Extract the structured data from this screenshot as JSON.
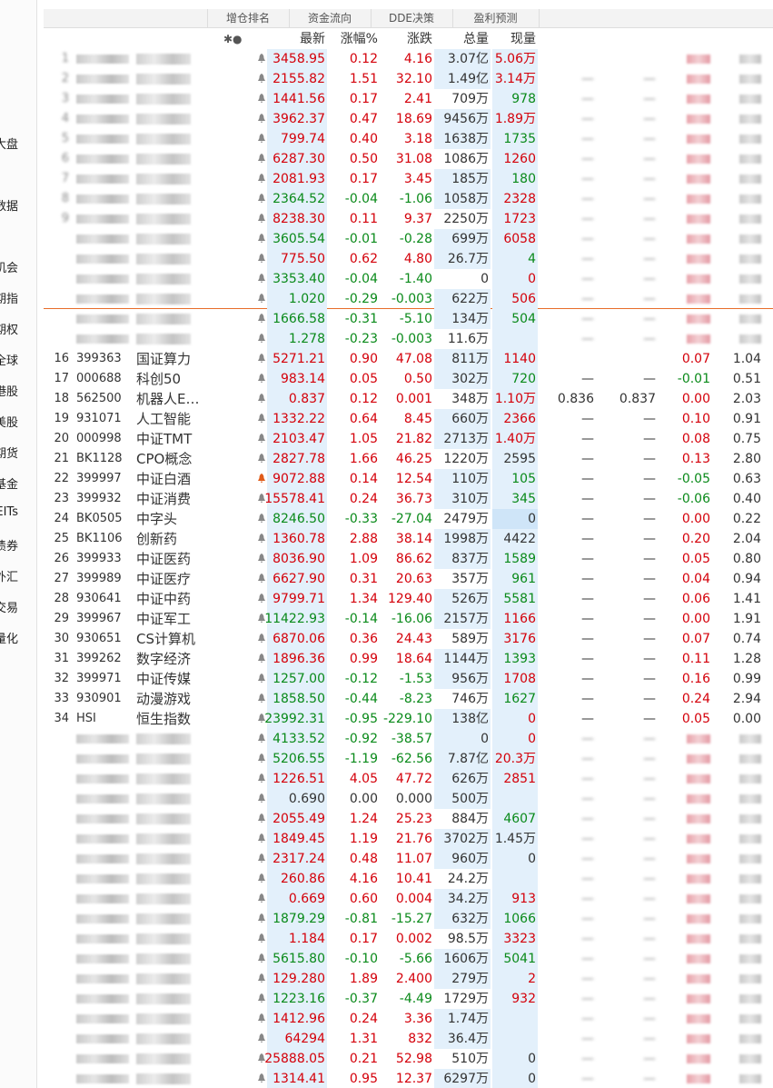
{
  "sidebar": {
    "items": [
      "大盘",
      "数据",
      "机会",
      "期指",
      "期权",
      "全球",
      "港股",
      "美股",
      "期货",
      "基金",
      "REITs",
      "债券",
      "外汇",
      "交易",
      "量化"
    ]
  },
  "top_tabs": [
    "增仓排名",
    "资金流向",
    "DDE决策",
    "盈利预测"
  ],
  "header": {
    "icons_label": "✱●",
    "latest": "最新",
    "pct": "涨幅%",
    "change": "涨跌",
    "volume": "总量",
    "now_vol": "现量"
  },
  "colors": {
    "up": "#d4000a",
    "down": "#0a8a1a",
    "highlight": "#e3f0fb",
    "bell": "#888888",
    "bell_active": "#e05c1a",
    "separator": "#e76d2a"
  },
  "rows": [
    {
      "idx": "1",
      "code": "",
      "name": "",
      "latest": "3458.95",
      "pct": "0.12",
      "chg": "4.16",
      "vol": "3.07亿",
      "now": "5.06万",
      "dir": "up",
      "c1": "",
      "c2": "",
      "c3": "",
      "c4": "",
      "blurred": true,
      "now_dir": "up"
    },
    {
      "idx": "2",
      "code": "",
      "name": "",
      "latest": "2155.82",
      "pct": "1.51",
      "chg": "32.10",
      "vol": "1.49亿",
      "now": "3.14万",
      "dir": "up",
      "c1": "—",
      "c2": "—",
      "c3": "",
      "c4": "",
      "blurred": true,
      "now_dir": "up"
    },
    {
      "idx": "3",
      "code": "",
      "name": "",
      "latest": "1441.56",
      "pct": "0.17",
      "chg": "2.41",
      "vol": "709万",
      "now": "978",
      "dir": "up",
      "c1": "—",
      "c2": "—",
      "c3": "",
      "c4": "",
      "blurred": true,
      "now_dir": "down"
    },
    {
      "idx": "4",
      "code": "",
      "name": "",
      "latest": "3962.37",
      "pct": "0.47",
      "chg": "18.69",
      "vol": "9456万",
      "now": "1.89万",
      "dir": "up",
      "c1": "—",
      "c2": "—",
      "c3": "",
      "c4": "",
      "blurred": true,
      "now_dir": "up"
    },
    {
      "idx": "5",
      "code": "",
      "name": "",
      "latest": "799.74",
      "pct": "0.40",
      "chg": "3.18",
      "vol": "1638万",
      "now": "1735",
      "dir": "up",
      "c1": "—",
      "c2": "—",
      "c3": "",
      "c4": "",
      "blurred": true,
      "now_dir": "down"
    },
    {
      "idx": "6",
      "code": "",
      "name": "",
      "latest": "6287.30",
      "pct": "0.50",
      "chg": "31.08",
      "vol": "1086万",
      "now": "1260",
      "dir": "up",
      "c1": "—",
      "c2": "—",
      "c3": "",
      "c4": "",
      "blurred": true,
      "now_dir": "up"
    },
    {
      "idx": "7",
      "code": "",
      "name": "",
      "latest": "2081.93",
      "pct": "0.17",
      "chg": "3.45",
      "vol": "185万",
      "now": "180",
      "dir": "up",
      "c1": "—",
      "c2": "—",
      "c3": "",
      "c4": "",
      "blurred": true,
      "now_dir": "down"
    },
    {
      "idx": "8",
      "code": "",
      "name": "",
      "latest": "2364.52",
      "pct": "-0.04",
      "chg": "-1.06",
      "vol": "1058万",
      "now": "2328",
      "dir": "down",
      "c1": "—",
      "c2": "—",
      "c3": "",
      "c4": "",
      "blurred": true,
      "now_dir": "up"
    },
    {
      "idx": "9",
      "code": "",
      "name": "",
      "latest": "8238.30",
      "pct": "0.11",
      "chg": "9.37",
      "vol": "2250万",
      "now": "1723",
      "dir": "up",
      "c1": "—",
      "c2": "—",
      "c3": "",
      "c4": "",
      "blurred": true,
      "now_dir": "up"
    },
    {
      "idx": "",
      "code": "",
      "name": "",
      "latest": "3605.54",
      "pct": "-0.01",
      "chg": "-0.28",
      "vol": "699万",
      "now": "6058",
      "dir": "down",
      "c1": "—",
      "c2": "—",
      "c3": "",
      "c4": "",
      "blurred": true,
      "now_dir": "up"
    },
    {
      "idx": "",
      "code": "",
      "name": "",
      "latest": "775.50",
      "pct": "0.62",
      "chg": "4.80",
      "vol": "26.7万",
      "now": "4",
      "dir": "up",
      "c1": "—",
      "c2": "—",
      "c3": "",
      "c4": "",
      "blurred": true,
      "now_dir": "down"
    },
    {
      "idx": "",
      "code": "",
      "name": "",
      "latest": "3353.40",
      "pct": "-0.04",
      "chg": "-1.40",
      "vol": "0",
      "now": "0",
      "dir": "down",
      "c1": "—",
      "c2": "—",
      "c3": "",
      "c4": "",
      "blurred": true,
      "now_dir": "up"
    },
    {
      "idx": "",
      "code": "",
      "name": "",
      "latest": "1.020",
      "pct": "-0.29",
      "chg": "-0.003",
      "vol": "622万",
      "now": "506",
      "dir": "down",
      "c1": "—",
      "c2": "—",
      "c3": "",
      "c4": "",
      "blurred": true,
      "now_dir": "up"
    },
    {
      "idx": "",
      "code": "",
      "name": "",
      "latest": "1666.58",
      "pct": "-0.31",
      "chg": "-5.10",
      "vol": "134万",
      "now": "504",
      "dir": "down",
      "c1": "—",
      "c2": "—",
      "c3": "",
      "c4": "",
      "blurred": true,
      "now_dir": "down"
    },
    {
      "idx": "",
      "code": "",
      "name": "",
      "latest": "1.278",
      "pct": "-0.23",
      "chg": "-0.003",
      "vol": "11.6万",
      "now": "",
      "dir": "down",
      "c1": "—",
      "c2": "—",
      "c3": "",
      "c4": "",
      "blurred": true,
      "now_dir": "down"
    },
    {
      "idx": "16",
      "code": "399363",
      "name": "国证算力",
      "latest": "5271.21",
      "pct": "0.90",
      "chg": "47.08",
      "vol": "811万",
      "now": "1140",
      "dir": "up",
      "c1": "",
      "c2": "",
      "c3": "0.07",
      "c4": "1.04",
      "blurred": false,
      "now_dir": "up"
    },
    {
      "idx": "17",
      "code": "000688",
      "name": "科创50",
      "latest": "983.14",
      "pct": "0.05",
      "chg": "0.50",
      "vol": "302万",
      "now": "720",
      "dir": "up",
      "c1": "—",
      "c2": "—",
      "c3": "-0.01",
      "c4": "0.51",
      "blurred": false,
      "now_dir": "down"
    },
    {
      "idx": "18",
      "code": "562500",
      "name": "机器人E…",
      "latest": "0.837",
      "pct": "0.12",
      "chg": "0.001",
      "vol": "348万",
      "now": "1.10万",
      "dir": "up",
      "c1": "0.836",
      "c2": "0.837",
      "c3": "0.00",
      "c4": "2.03",
      "blurred": false,
      "now_dir": "up"
    },
    {
      "idx": "19",
      "code": "931071",
      "name": "人工智能",
      "latest": "1332.22",
      "pct": "0.64",
      "chg": "8.45",
      "vol": "660万",
      "now": "2366",
      "dir": "up",
      "c1": "—",
      "c2": "—",
      "c3": "0.10",
      "c4": "0.91",
      "blurred": false,
      "now_dir": "up"
    },
    {
      "idx": "20",
      "code": "000998",
      "name": "中证TMT",
      "latest": "2103.47",
      "pct": "1.05",
      "chg": "21.82",
      "vol": "2713万",
      "now": "1.40万",
      "dir": "up",
      "c1": "—",
      "c2": "—",
      "c3": "0.08",
      "c4": "0.75",
      "blurred": false,
      "now_dir": "up"
    },
    {
      "idx": "21",
      "code": "BK1128",
      "name": "CPO概念",
      "latest": "2827.78",
      "pct": "1.66",
      "chg": "46.25",
      "vol": "1220万",
      "now": "2595",
      "dir": "up",
      "c1": "—",
      "c2": "—",
      "c3": "0.13",
      "c4": "2.80",
      "blurred": false,
      "now_dir": "blk"
    },
    {
      "idx": "22",
      "code": "399997",
      "name": "中证白酒",
      "latest": "9072.88",
      "pct": "0.14",
      "chg": "12.54",
      "vol": "110万",
      "now": "105",
      "dir": "up",
      "c1": "—",
      "c2": "—",
      "c3": "-0.05",
      "c4": "0.63",
      "blurred": false,
      "now_dir": "down"
    },
    {
      "idx": "23",
      "code": "399932",
      "name": "中证消费",
      "latest": "15578.41",
      "pct": "0.24",
      "chg": "36.73",
      "vol": "310万",
      "now": "345",
      "dir": "up",
      "c1": "—",
      "c2": "—",
      "c3": "-0.06",
      "c4": "0.40",
      "blurred": false,
      "now_dir": "down"
    },
    {
      "idx": "24",
      "code": "BK0505",
      "name": "中字头",
      "latest": "8246.50",
      "pct": "-0.33",
      "chg": "-27.04",
      "vol": "2479万",
      "now": "0",
      "dir": "down",
      "c1": "—",
      "c2": "—",
      "c3": "0.00",
      "c4": "0.22",
      "blurred": false,
      "now_dir": "blk"
    },
    {
      "idx": "25",
      "code": "BK1106",
      "name": "创新药",
      "latest": "1360.78",
      "pct": "2.88",
      "chg": "38.14",
      "vol": "1998万",
      "now": "4422",
      "dir": "up",
      "c1": "—",
      "c2": "—",
      "c3": "0.20",
      "c4": "2.04",
      "blurred": false,
      "now_dir": "blk"
    },
    {
      "idx": "26",
      "code": "399933",
      "name": "中证医药",
      "latest": "8036.90",
      "pct": "1.09",
      "chg": "86.62",
      "vol": "837万",
      "now": "1589",
      "dir": "up",
      "c1": "—",
      "c2": "—",
      "c3": "0.05",
      "c4": "0.80",
      "blurred": false,
      "now_dir": "down"
    },
    {
      "idx": "27",
      "code": "399989",
      "name": "中证医疗",
      "latest": "6627.90",
      "pct": "0.31",
      "chg": "20.63",
      "vol": "357万",
      "now": "961",
      "dir": "up",
      "c1": "—",
      "c2": "—",
      "c3": "0.04",
      "c4": "0.94",
      "blurred": false,
      "now_dir": "down"
    },
    {
      "idx": "28",
      "code": "930641",
      "name": "中证中药",
      "latest": "9799.71",
      "pct": "1.34",
      "chg": "129.40",
      "vol": "526万",
      "now": "5581",
      "dir": "up",
      "c1": "—",
      "c2": "—",
      "c3": "0.06",
      "c4": "1.41",
      "blurred": false,
      "now_dir": "down"
    },
    {
      "idx": "29",
      "code": "399967",
      "name": "中证军工",
      "latest": "11422.93",
      "pct": "-0.14",
      "chg": "-16.06",
      "vol": "2157万",
      "now": "1166",
      "dir": "down",
      "c1": "—",
      "c2": "—",
      "c3": "0.00",
      "c4": "1.91",
      "blurred": false,
      "now_dir": "up"
    },
    {
      "idx": "30",
      "code": "930651",
      "name": "CS计算机",
      "latest": "6870.06",
      "pct": "0.36",
      "chg": "24.43",
      "vol": "589万",
      "now": "3176",
      "dir": "up",
      "c1": "—",
      "c2": "—",
      "c3": "0.07",
      "c4": "0.74",
      "blurred": false,
      "now_dir": "up"
    },
    {
      "idx": "31",
      "code": "399262",
      "name": "数字经济",
      "latest": "1896.36",
      "pct": "0.99",
      "chg": "18.64",
      "vol": "1144万",
      "now": "1393",
      "dir": "up",
      "c1": "—",
      "c2": "—",
      "c3": "0.11",
      "c4": "1.28",
      "blurred": false,
      "now_dir": "down"
    },
    {
      "idx": "32",
      "code": "399971",
      "name": "中证传媒",
      "latest": "1257.00",
      "pct": "-0.12",
      "chg": "-1.53",
      "vol": "956万",
      "now": "1708",
      "dir": "down",
      "c1": "—",
      "c2": "—",
      "c3": "0.16",
      "c4": "0.99",
      "blurred": false,
      "now_dir": "up"
    },
    {
      "idx": "33",
      "code": "930901",
      "name": "动漫游戏",
      "latest": "1858.50",
      "pct": "-0.44",
      "chg": "-8.23",
      "vol": "746万",
      "now": "1627",
      "dir": "down",
      "c1": "—",
      "c2": "—",
      "c3": "0.24",
      "c4": "2.94",
      "blurred": false,
      "now_dir": "down"
    },
    {
      "idx": "34",
      "code": "HSI",
      "name": "恒生指数",
      "latest": "23992.31",
      "pct": "-0.95",
      "chg": "-229.10",
      "vol": "138亿",
      "now": "0",
      "dir": "down",
      "c1": "—",
      "c2": "—",
      "c3": "0.05",
      "c4": "0.00",
      "blurred": false,
      "now_dir": "up"
    },
    {
      "idx": "",
      "code": "",
      "name": "",
      "latest": "4133.52",
      "pct": "-0.92",
      "chg": "-38.57",
      "vol": "0",
      "now": "0",
      "dir": "down",
      "c1": "—",
      "c2": "—",
      "c3": "",
      "c4": "",
      "blurred": true,
      "now_dir": "up"
    },
    {
      "idx": "",
      "code": "",
      "name": "",
      "latest": "5206.55",
      "pct": "-1.19",
      "chg": "-62.56",
      "vol": "7.87亿",
      "now": "20.3万",
      "dir": "down",
      "c1": "—",
      "c2": "—",
      "c3": "",
      "c4": "",
      "blurred": true,
      "now_dir": "up"
    },
    {
      "idx": "",
      "code": "",
      "name": "",
      "latest": "1226.51",
      "pct": "4.05",
      "chg": "47.72",
      "vol": "626万",
      "now": "2851",
      "dir": "up",
      "c1": "—",
      "c2": "—",
      "c3": "",
      "c4": "",
      "blurred": true,
      "now_dir": "up"
    },
    {
      "idx": "",
      "code": "",
      "name": "",
      "latest": "0.690",
      "pct": "0.00",
      "chg": "0.000",
      "vol": "500万",
      "now": "",
      "dir": "blk",
      "c1": "—",
      "c2": "—",
      "c3": "",
      "c4": "",
      "blurred": true,
      "now_dir": "up"
    },
    {
      "idx": "",
      "code": "",
      "name": "",
      "latest": "2055.49",
      "pct": "1.24",
      "chg": "25.23",
      "vol": "884万",
      "now": "4607",
      "dir": "up",
      "c1": "—",
      "c2": "—",
      "c3": "",
      "c4": "",
      "blurred": true,
      "now_dir": "down"
    },
    {
      "idx": "",
      "code": "",
      "name": "",
      "latest": "1849.45",
      "pct": "1.19",
      "chg": "21.76",
      "vol": "3702万",
      "now": "1.45万",
      "dir": "up",
      "c1": "—",
      "c2": "—",
      "c3": "",
      "c4": "",
      "blurred": true,
      "now_dir": "blk"
    },
    {
      "idx": "",
      "code": "",
      "name": "",
      "latest": "2317.24",
      "pct": "0.48",
      "chg": "11.07",
      "vol": "960万",
      "now": "0",
      "dir": "up",
      "c1": "—",
      "c2": "—",
      "c3": "",
      "c4": "",
      "blurred": true,
      "now_dir": "blk"
    },
    {
      "idx": "",
      "code": "",
      "name": "",
      "latest": "260.86",
      "pct": "4.16",
      "chg": "10.41",
      "vol": "24.2万",
      "now": "",
      "dir": "up",
      "c1": "—",
      "c2": "—",
      "c3": "",
      "c4": "",
      "blurred": true,
      "now_dir": "down"
    },
    {
      "idx": "",
      "code": "",
      "name": "",
      "latest": "0.669",
      "pct": "0.60",
      "chg": "0.004",
      "vol": "34.2万",
      "now": "913",
      "dir": "up",
      "c1": "—",
      "c2": "—",
      "c3": "",
      "c4": "",
      "blurred": true,
      "now_dir": "up"
    },
    {
      "idx": "",
      "code": "",
      "name": "",
      "latest": "1879.29",
      "pct": "-0.81",
      "chg": "-15.27",
      "vol": "632万",
      "now": "1066",
      "dir": "down",
      "c1": "—",
      "c2": "—",
      "c3": "",
      "c4": "",
      "blurred": true,
      "now_dir": "down"
    },
    {
      "idx": "",
      "code": "",
      "name": "",
      "latest": "1.184",
      "pct": "0.17",
      "chg": "0.002",
      "vol": "98.5万",
      "now": "3323",
      "dir": "up",
      "c1": "—",
      "c2": "—",
      "c3": "",
      "c4": "",
      "blurred": true,
      "now_dir": "up"
    },
    {
      "idx": "",
      "code": "",
      "name": "",
      "latest": "5615.80",
      "pct": "-0.10",
      "chg": "-5.66",
      "vol": "1606万",
      "now": "5041",
      "dir": "down",
      "c1": "—",
      "c2": "—",
      "c3": "",
      "c4": "",
      "blurred": true,
      "now_dir": "down"
    },
    {
      "idx": "",
      "code": "",
      "name": "",
      "latest": "129.280",
      "pct": "1.89",
      "chg": "2.400",
      "vol": "279万",
      "now": "2",
      "dir": "up",
      "c1": "—",
      "c2": "—",
      "c3": "",
      "c4": "",
      "blurred": true,
      "now_dir": "up"
    },
    {
      "idx": "",
      "code": "",
      "name": "",
      "latest": "1223.16",
      "pct": "-0.37",
      "chg": "-4.49",
      "vol": "1729万",
      "now": "932",
      "dir": "down",
      "c1": "—",
      "c2": "—",
      "c3": "",
      "c4": "",
      "blurred": true,
      "now_dir": "up"
    },
    {
      "idx": "",
      "code": "",
      "name": "",
      "latest": "1412.96",
      "pct": "0.24",
      "chg": "3.36",
      "vol": "1.74万",
      "now": "",
      "dir": "up",
      "c1": "—",
      "c2": "—",
      "c3": "",
      "c4": "",
      "blurred": true,
      "now_dir": "up"
    },
    {
      "idx": "",
      "code": "",
      "name": "",
      "latest": "64294",
      "pct": "1.31",
      "chg": "832",
      "vol": "36.4万",
      "now": "",
      "dir": "up",
      "c1": "—",
      "c2": "—",
      "c3": "",
      "c4": "",
      "blurred": true,
      "now_dir": "up"
    },
    {
      "idx": "",
      "code": "",
      "name": "",
      "latest": "25888.05",
      "pct": "0.21",
      "chg": "52.98",
      "vol": "510万",
      "now": "0",
      "dir": "up",
      "c1": "—",
      "c2": "—",
      "c3": "",
      "c4": "",
      "blurred": true,
      "now_dir": "blk"
    },
    {
      "idx": "",
      "code": "",
      "name": "",
      "latest": "1314.41",
      "pct": "0.95",
      "chg": "12.37",
      "vol": "6297万",
      "now": "0",
      "dir": "up",
      "c1": "—",
      "c2": "—",
      "c3": "",
      "c4": "",
      "blurred": true,
      "now_dir": "blk"
    }
  ]
}
